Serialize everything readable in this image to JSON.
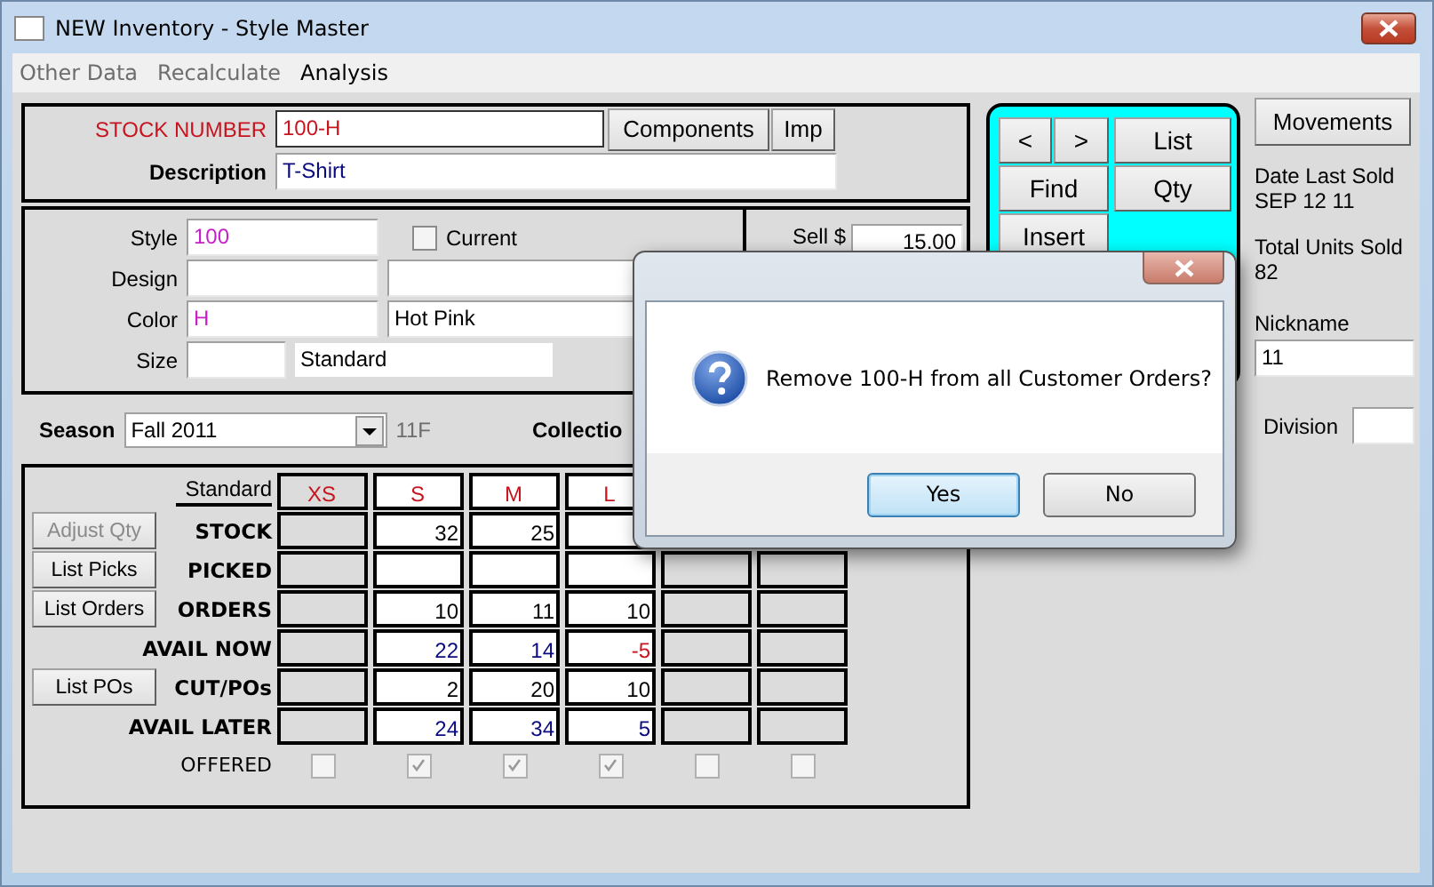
{
  "window": {
    "title": "NEW Inventory - Style Master"
  },
  "menu": [
    {
      "label": "Other Data",
      "disabled": true
    },
    {
      "label": "Recalculate",
      "disabled": true
    },
    {
      "label": "Analysis",
      "disabled": false
    }
  ],
  "stock": {
    "stock_number_label": "STOCK NUMBER",
    "stock_number": "100-H",
    "description_label": "Description",
    "description": "T-Shirt",
    "buttons": [
      "Components",
      "Imp"
    ]
  },
  "details": {
    "style_label": "Style",
    "style": "100",
    "current_label": "Current",
    "current_checked": false,
    "design_label": "Design",
    "color_label": "Color",
    "color_code": "H",
    "color_name": "Hot Pink",
    "size_label": "Size",
    "size_name": "Standard",
    "sell_label": "Sell $",
    "sell": "15.00"
  },
  "season": {
    "label": "Season",
    "value": "Fall  2011",
    "code": "11F",
    "collection_label": "Collectio"
  },
  "size_grid": {
    "scale": "Standard",
    "columns": [
      {
        "label": "XS",
        "enabled": false
      },
      {
        "label": "S",
        "enabled": true
      },
      {
        "label": "M",
        "enabled": true
      },
      {
        "label": "L",
        "enabled": true
      },
      {
        "enabled": false
      },
      {
        "enabled": false
      }
    ],
    "rows": [
      {
        "label": "STOCK",
        "kind": "count",
        "button": {
          "label": "Adjust Qty",
          "disabled": true
        },
        "values": [
          {
            "text": "32",
            "negative": false
          },
          {
            "text": "25",
            "negative": false
          }
        ]
      },
      {
        "label": "PICKED",
        "button": {
          "label": "List Picks",
          "disabled": false
        }
      },
      {
        "label": "ORDERS",
        "kind": "count",
        "button": {
          "label": "List Orders",
          "disabled": false
        },
        "values": [
          {
            "text": "10",
            "negative": false
          },
          {
            "text": "11",
            "negative": false
          },
          {
            "text": "10",
            "negative": false
          }
        ]
      },
      {
        "label": "AVAIL NOW",
        "kind": "avail",
        "values": [
          {
            "text": "22",
            "negative": false
          },
          {
            "text": "14",
            "negative": false
          },
          {
            "text": "-5",
            "negative": true
          }
        ]
      },
      {
        "label": "CUT/POs",
        "kind": "count",
        "button": {
          "label": "List POs",
          "disabled": false
        },
        "values": [
          {
            "text": "2",
            "negative": false
          },
          {
            "text": "20",
            "negative": false
          },
          {
            "text": "10",
            "negative": false
          }
        ]
      },
      {
        "label": "AVAIL LATER",
        "kind": "avail",
        "values": [
          {
            "text": "24",
            "negative": false
          },
          {
            "text": "34",
            "negative": false
          },
          {
            "text": "5",
            "negative": false
          }
        ]
      }
    ],
    "offered_label": "OFFERED",
    "offered": [
      {
        "checked": false
      },
      {
        "checked": true
      },
      {
        "checked": true
      },
      {
        "checked": true
      },
      {
        "checked": false
      },
      {
        "checked": false
      }
    ]
  },
  "navigator": {
    "buttons": [
      "<",
      ">",
      "List",
      "Find",
      "Qty",
      "Insert"
    ]
  },
  "side": {
    "movements": "Movements",
    "date_last_sold_label": "Date Last Sold",
    "date_last_sold": "SEP 12 11",
    "total_units_sold_label": "Total Units Sold",
    "total_units_sold": "82",
    "nickname_label": "Nickname",
    "nickname": "11",
    "division_label": "Division"
  },
  "dialog": {
    "message": "Remove 100-H from all Customer Orders?",
    "buttons": [
      {
        "label": "Yes",
        "selected": true
      },
      {
        "label": "No",
        "selected": false
      }
    ]
  }
}
